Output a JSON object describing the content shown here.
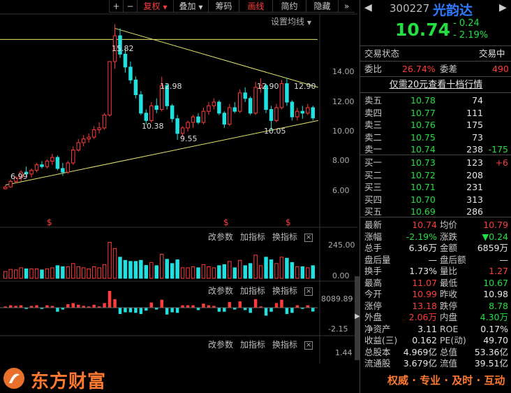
{
  "toolbar": {
    "plus": "+",
    "minus": "−",
    "fuquan": "复权",
    "diejia": "叠加",
    "chouma": "筹码",
    "huaxian": "画线",
    "jianyue": "简约",
    "yincang": "隐藏",
    "more": "»"
  },
  "chart": {
    "ma_setting": "设置均线",
    "price_ticks": [
      "14.00",
      "12.00",
      "10.00",
      "8.00",
      "6.00"
    ],
    "annotations": {
      "high": "15.82",
      "low": "6.99",
      "p1298": "12.98",
      "p1038": "10.38",
      "p955": "9.55",
      "p1290a": "12.90",
      "p1290b": "12.90",
      "p1005": "10.05"
    },
    "s_marker": "$",
    "volume_ticks": [
      "245.00",
      "0.00"
    ],
    "macd_ticks": [
      "8089.89",
      "-2.15"
    ],
    "kdj_ticks": [
      "1.44"
    ],
    "panel_controls": {
      "gaicanshu": "改参数",
      "jiazhibiao": "加指标",
      "huanzhibiao": "换指标",
      "close": "×"
    }
  },
  "chart_data": {
    "type": "candlestick",
    "candles": [
      [
        6.9,
        7.1,
        6.85,
        6.99
      ],
      [
        7.0,
        7.4,
        6.95,
        7.3
      ],
      [
        7.3,
        7.6,
        7.2,
        7.5
      ],
      [
        7.5,
        7.9,
        7.3,
        7.8
      ],
      [
        7.8,
        8.1,
        7.6,
        7.7
      ],
      [
        7.7,
        8.0,
        7.5,
        7.9
      ],
      [
        7.9,
        8.3,
        7.8,
        8.2
      ],
      [
        8.2,
        8.4,
        8.0,
        8.1
      ],
      [
        8.1,
        8.5,
        8.0,
        8.4
      ],
      [
        8.4,
        8.8,
        8.2,
        8.6
      ],
      [
        8.6,
        8.7,
        7.9,
        8.0
      ],
      [
        8.0,
        8.3,
        7.6,
        7.8
      ],
      [
        7.8,
        8.4,
        7.7,
        8.3
      ],
      [
        8.3,
        9.2,
        8.2,
        9.0
      ],
      [
        9.0,
        9.6,
        8.9,
        9.4
      ],
      [
        9.4,
        9.8,
        9.2,
        9.6
      ],
      [
        9.6,
        9.9,
        9.4,
        9.7
      ],
      [
        9.7,
        10.3,
        9.6,
        10.1
      ],
      [
        10.1,
        10.5,
        9.9,
        10.2
      ],
      [
        10.2,
        11.0,
        10.1,
        10.9
      ],
      [
        10.9,
        13.8,
        10.8,
        13.8
      ],
      [
        13.8,
        15.82,
        13.4,
        15.2
      ],
      [
        15.2,
        15.6,
        14.0,
        14.2
      ],
      [
        14.2,
        14.5,
        13.2,
        13.5
      ],
      [
        13.5,
        13.8,
        12.6,
        12.8
      ],
      [
        12.8,
        13.0,
        11.8,
        12.0
      ],
      [
        12.0,
        12.2,
        10.9,
        11.0
      ],
      [
        11.0,
        11.2,
        10.38,
        10.6
      ],
      [
        10.6,
        11.6,
        10.5,
        11.4
      ],
      [
        11.4,
        11.8,
        11.0,
        11.2
      ],
      [
        11.2,
        12.98,
        11.1,
        12.5
      ],
      [
        12.5,
        12.6,
        11.2,
        11.4
      ],
      [
        11.4,
        11.5,
        10.5,
        10.7
      ],
      [
        10.7,
        10.9,
        9.55,
        9.9
      ],
      [
        9.9,
        10.3,
        9.7,
        10.2
      ],
      [
        10.2,
        10.6,
        10.0,
        10.5
      ],
      [
        10.5,
        10.9,
        10.2,
        10.8
      ],
      [
        10.8,
        11.0,
        10.4,
        10.5
      ],
      [
        10.5,
        11.3,
        10.4,
        11.1
      ],
      [
        11.1,
        11.6,
        10.9,
        11.4
      ],
      [
        11.4,
        11.8,
        11.2,
        11.6
      ],
      [
        11.6,
        11.7,
        10.9,
        11.0
      ],
      [
        11.0,
        11.1,
        10.2,
        10.4
      ],
      [
        10.4,
        11.5,
        10.3,
        11.3
      ],
      [
        11.3,
        11.6,
        11.0,
        11.1
      ],
      [
        11.1,
        12.3,
        11.0,
        12.1
      ],
      [
        12.1,
        12.4,
        11.6,
        11.8
      ],
      [
        11.8,
        11.9,
        10.9,
        11.0
      ],
      [
        11.0,
        12.7,
        10.9,
        12.4
      ],
      [
        12.4,
        12.9,
        12.1,
        12.5
      ],
      [
        12.5,
        12.6,
        11.0,
        11.2
      ],
      [
        11.2,
        11.4,
        10.05,
        10.6
      ],
      [
        10.6,
        11.5,
        10.5,
        11.3
      ],
      [
        11.3,
        12.8,
        11.2,
        12.6
      ],
      [
        12.6,
        12.9,
        11.4,
        11.6
      ],
      [
        11.6,
        11.7,
        10.6,
        10.8
      ],
      [
        10.8,
        11.3,
        10.6,
        11.1
      ],
      [
        11.1,
        11.4,
        10.7,
        11.0
      ],
      [
        11.0,
        11.5,
        10.9,
        11.3
      ],
      [
        11.3,
        11.4,
        10.6,
        10.74
      ]
    ],
    "price_axis": [
      5,
      16
    ],
    "volume_axis": [
      0,
      245
    ],
    "trendlines": {
      "horizontal": 15.0,
      "upper": [
        [
          21,
          15.6
        ],
        [
          60,
          12.4
        ]
      ],
      "lower": [
        [
          0,
          7.1
        ],
        [
          60,
          10.6
        ]
      ]
    }
  },
  "quote": {
    "code": "300227",
    "name": "光韵达",
    "price": "10.74",
    "change": "- 0.24",
    "change_pct": "- 2.19%",
    "status_label": "交易状态",
    "status_value": "交易中",
    "weibi_label": "委比",
    "weibi_value": "26.74%",
    "weicha_label": "委差",
    "weicha_value": "490",
    "promo": "仅需20元查看十档行情"
  },
  "orderbook": {
    "asks": [
      {
        "label": "卖五",
        "price": "10.78",
        "vol": "74",
        "chg": ""
      },
      {
        "label": "卖四",
        "price": "10.77",
        "vol": "111",
        "chg": ""
      },
      {
        "label": "卖三",
        "price": "10.76",
        "vol": "175",
        "chg": ""
      },
      {
        "label": "卖二",
        "price": "10.75",
        "vol": "73",
        "chg": ""
      },
      {
        "label": "卖一",
        "price": "10.74",
        "vol": "238",
        "chg": "-175"
      }
    ],
    "bids": [
      {
        "label": "买一",
        "price": "10.73",
        "vol": "123",
        "chg": "+6"
      },
      {
        "label": "买二",
        "price": "10.72",
        "vol": "208",
        "chg": ""
      },
      {
        "label": "买三",
        "price": "10.71",
        "vol": "231",
        "chg": ""
      },
      {
        "label": "买四",
        "price": "10.70",
        "vol": "313",
        "chg": ""
      },
      {
        "label": "买五",
        "price": "10.69",
        "vol": "286",
        "chg": ""
      }
    ]
  },
  "stats": [
    {
      "l1": "最新",
      "v1": "10.74",
      "c1": "red",
      "l2": "均价",
      "v2": "10.79",
      "c2": "red"
    },
    {
      "l1": "涨幅",
      "v1": "-2.19%",
      "c1": "grn",
      "l2": "涨跌",
      "v2": "▼0.24",
      "c2": "grn"
    },
    {
      "l1": "总手",
      "v1": "6.36万",
      "c1": "wht",
      "l2": "金额",
      "v2": "6859万",
      "c2": "wht"
    },
    {
      "l1": "盘后量",
      "v1": "—",
      "c1": "wht",
      "l2": "盘后额",
      "v2": "—",
      "c2": "wht"
    },
    {
      "l1": "换手",
      "v1": "1.73%",
      "c1": "wht",
      "l2": "量比",
      "v2": "1.27",
      "c2": "red"
    },
    {
      "l1": "最高",
      "v1": "11.07",
      "c1": "red",
      "l2": "最低",
      "v2": "10.67",
      "c2": "grn"
    },
    {
      "l1": "今开",
      "v1": "10.99",
      "c1": "red",
      "l2": "昨收",
      "v2": "10.98",
      "c2": "wht"
    },
    {
      "l1": "涨停",
      "v1": "13.18",
      "c1": "red",
      "l2": "跌停",
      "v2": "8.78",
      "c2": "grn"
    },
    {
      "l1": "外盘",
      "v1": "2.06万",
      "c1": "red",
      "l2": "内盘",
      "v2": "4.30万",
      "c2": "grn"
    },
    {
      "l1": "净资产",
      "v1": "3.11",
      "c1": "wht",
      "l2": "ROE",
      "v2": "0.17%",
      "c2": "wht"
    },
    {
      "l1": "收益(三)",
      "v1": "0.162",
      "c1": "wht",
      "l2": "PE(动)",
      "v2": "49.70",
      "c2": "wht"
    },
    {
      "l1": "总股本",
      "v1": "4.969亿",
      "c1": "wht",
      "l2": "总值",
      "v2": "53.36亿",
      "c2": "wht"
    },
    {
      "l1": "流通股",
      "v1": "3.679亿",
      "c1": "wht",
      "l2": "流值",
      "v2": "39.51亿",
      "c2": "wht"
    }
  ],
  "footer": {
    "logo": "东方财富",
    "slogan": "权威 · 专业 · 及时 · 互动"
  },
  "colors": {
    "up": "#ff3b3b",
    "down": "#21e0e0",
    "accent": "#ff7a2f",
    "green": "#21e040"
  }
}
